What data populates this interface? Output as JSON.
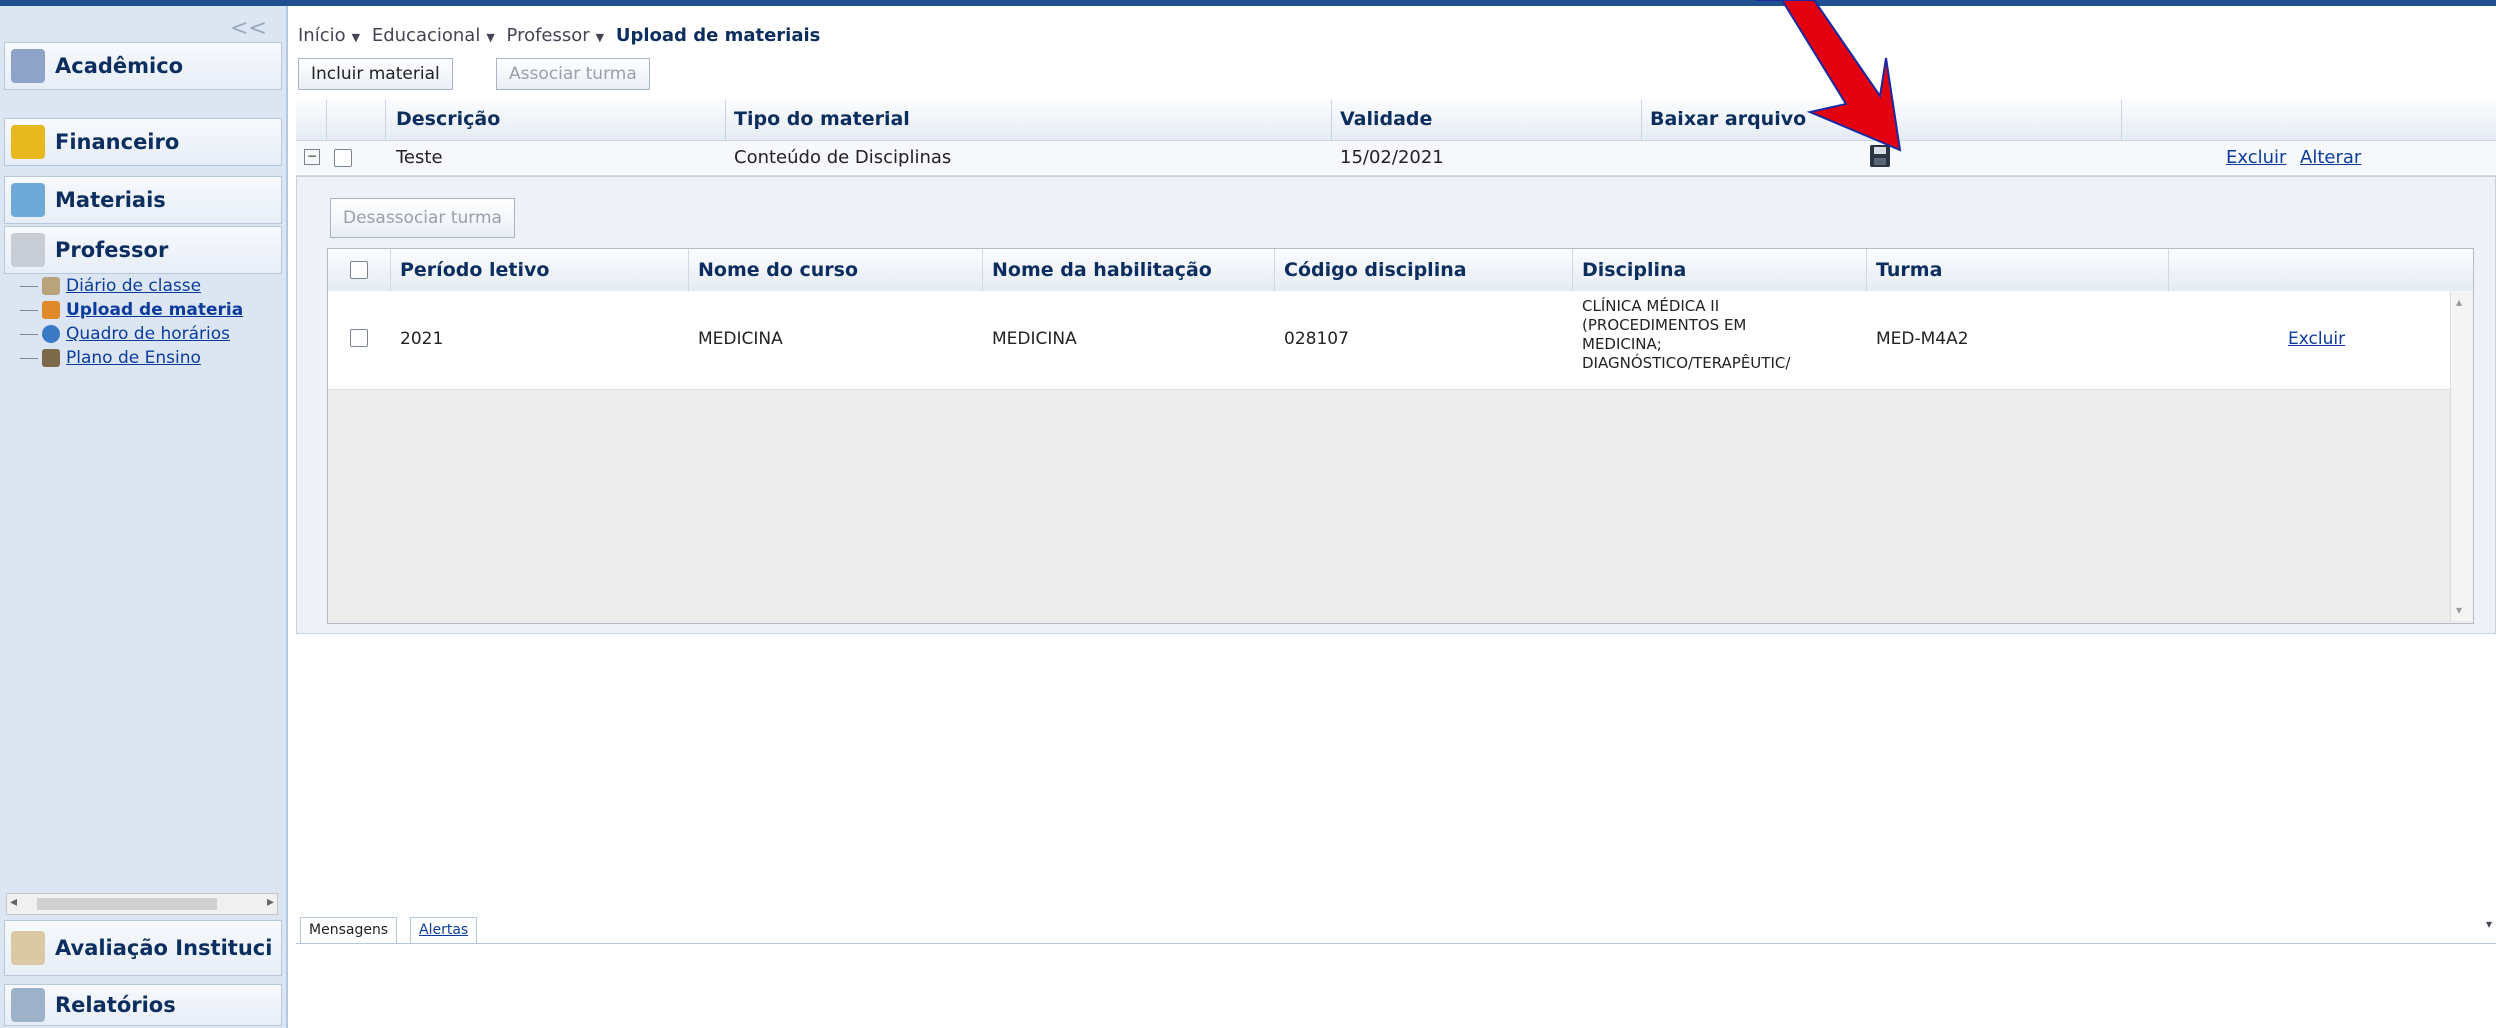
{
  "breadcrumb": {
    "inicio": "Início",
    "educacional": "Educacional",
    "professor": "Professor",
    "current": "Upload de materiais"
  },
  "sidebar": {
    "collapse_glyph": "<<",
    "sections": [
      {
        "label": "Acadêmico",
        "icon": "academic-icon"
      },
      {
        "label": "Financeiro",
        "icon": "money-icon"
      },
      {
        "label": "Materiais",
        "icon": "folder-icon"
      },
      {
        "label": "Professor",
        "icon": "teacher-icon"
      }
    ],
    "items": [
      {
        "label": "Diário de classe",
        "icon": "book-icon"
      },
      {
        "label": "Upload de materia",
        "icon": "upload-icon"
      },
      {
        "label": "Quadro de horários",
        "icon": "clock-icon"
      },
      {
        "label": "Plano de Ensino",
        "icon": "plan-icon"
      }
    ],
    "bottom": [
      {
        "label": "Avaliação Instituci",
        "icon": "evaluation-icon"
      },
      {
        "label": "Relatórios",
        "icon": "report-icon"
      }
    ]
  },
  "toolbar": {
    "incluir": "Incluir material",
    "associar": "Associar turma"
  },
  "materials_table": {
    "headers": [
      "Descrição",
      "Tipo do material",
      "Validade",
      "Baixar arquivo"
    ],
    "row": {
      "descricao": "Teste",
      "tipo": "Conteúdo de Disciplinas",
      "validade": "15/02/2021",
      "excluir": "Excluir",
      "alterar": "Alterar"
    }
  },
  "detail": {
    "desassociar": "Desassociar turma",
    "headers": [
      "Período letivo",
      "Nome do curso",
      "Nome da habilitação",
      "Código disciplina",
      "Disciplina",
      "Turma"
    ],
    "row": {
      "periodo": "2021",
      "curso": "MEDICINA",
      "habilitacao": "MEDICINA",
      "codigo": "028107",
      "disciplina_l1": "CLÍNICA MÉDICA II",
      "disciplina_l2": "(PROCEDIMENTOS EM",
      "disciplina_l3": "MEDICINA;",
      "disciplina_l4": "DIAGNÓSTICO/TERAPÊUTIC/",
      "turma": "MED-M4A2",
      "excluir": "Excluir"
    }
  },
  "bottom_tabs": {
    "mensagens": "Mensagens",
    "alertas": "Alertas"
  },
  "colors": {
    "annotation_arrow": "#e3000f",
    "header_text": "#0c2e5e",
    "link": "#0b3c9c"
  }
}
